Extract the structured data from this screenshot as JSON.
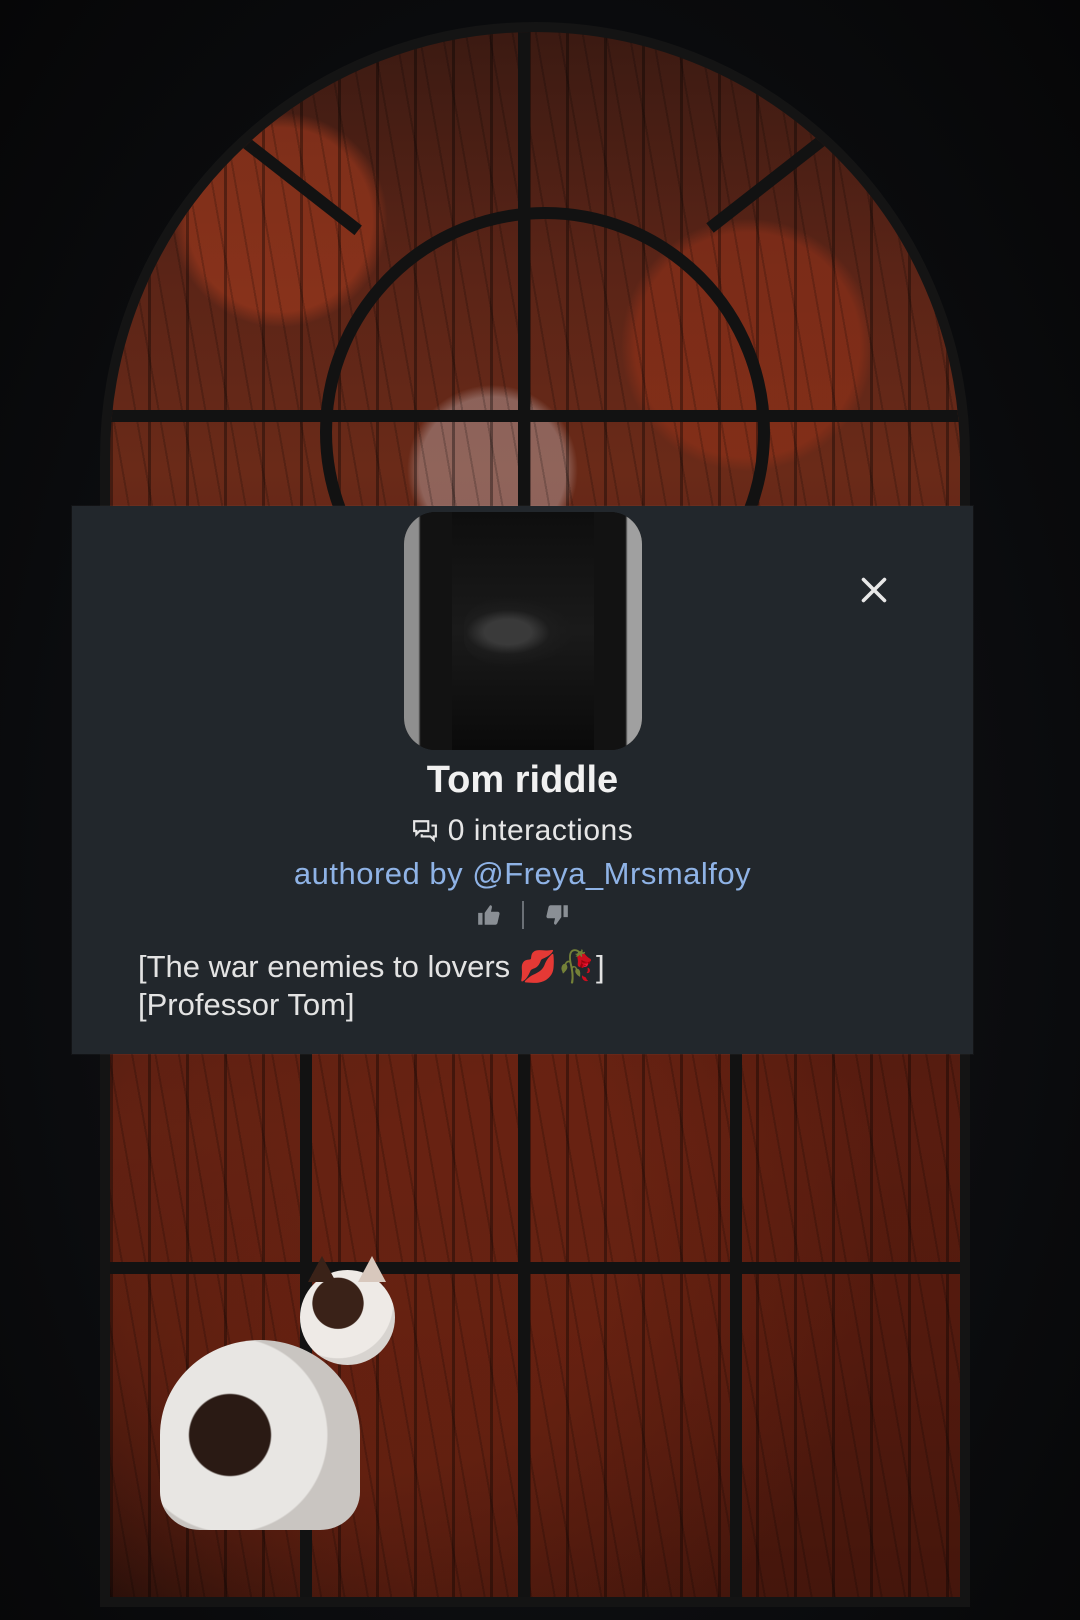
{
  "card": {
    "title": "Tom riddle",
    "interactions": "0 interactions",
    "author": "authored by @Freya_Mrsmalfoy",
    "description": [
      "[The war enemies to lovers 💋🥀]",
      "[Professor Tom]"
    ]
  },
  "icons": {
    "close": "close-icon",
    "interactions": "chat-bubbles-icon",
    "like": "thumbs-up-icon",
    "dislike": "thumbs-down-icon"
  },
  "colors": {
    "card_background": "#22272c",
    "author_link": "#8fb3e6",
    "title_text": "#f1f1f1"
  }
}
